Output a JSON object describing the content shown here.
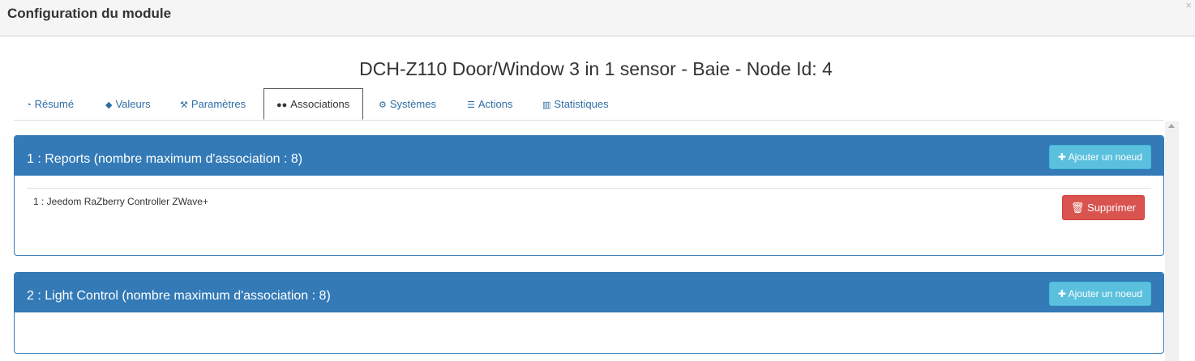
{
  "dialog": {
    "title": "Configuration du module",
    "close_label": "×"
  },
  "node": {
    "title": "DCH-Z110 Door/Window 3 in 1 sensor - Baie - Node Id: 4"
  },
  "tabs": [
    {
      "label": "Résumé",
      "icon": "tachometer-icon",
      "glyph": "◔"
    },
    {
      "label": "Valeurs",
      "icon": "tag-icon",
      "glyph": "◆"
    },
    {
      "label": "Paramètres",
      "icon": "wrench-icon",
      "glyph": "⚒"
    },
    {
      "label": "Associations",
      "icon": "users-icon",
      "glyph": "●●",
      "active": true
    },
    {
      "label": "Systèmes",
      "icon": "cogs-icon",
      "glyph": "⚙"
    },
    {
      "label": "Actions",
      "icon": "sliders-icon",
      "glyph": "☰"
    },
    {
      "label": "Statistiques",
      "icon": "bar-chart-icon",
      "glyph": "▥"
    }
  ],
  "groups": [
    {
      "title": "1 : Reports (nombre maximum d'association : 8)",
      "add_label": "Ajouter un noeud",
      "nodes": [
        {
          "label": "1 : Jeedom RaZberry Controller ZWave+",
          "delete_label": "Supprimer"
        }
      ]
    },
    {
      "title": "2 : Light Control (nombre maximum d'association : 8)",
      "add_label": "Ajouter un noeud",
      "nodes": []
    }
  ],
  "colors": {
    "primary": "#337ab7",
    "info": "#5bc0de",
    "danger": "#d9534f",
    "link": "#2e6da4"
  }
}
